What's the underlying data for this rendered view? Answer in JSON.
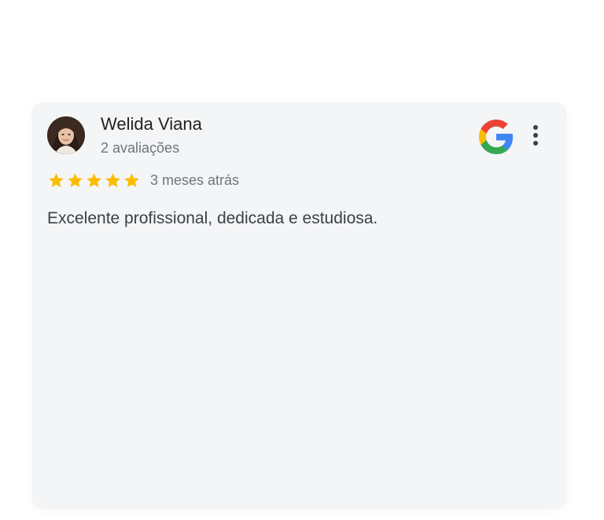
{
  "review": {
    "author_name": "Welida Viana",
    "review_count": "2 avaliações",
    "rating": 5,
    "rating_max": 5,
    "date": "3 meses atrás",
    "text": "Excelente profissional, dedicada e estudiosa."
  },
  "icons": {
    "brand": "google-icon",
    "menu": "more-vertical-icon",
    "star": "star-icon"
  },
  "colors": {
    "card_background": "#f4f5f7",
    "star": "#fbbc04",
    "google_blue": "#4285f4",
    "google_red": "#ea4335",
    "google_yellow": "#fbbc05",
    "google_green": "#34a853"
  }
}
